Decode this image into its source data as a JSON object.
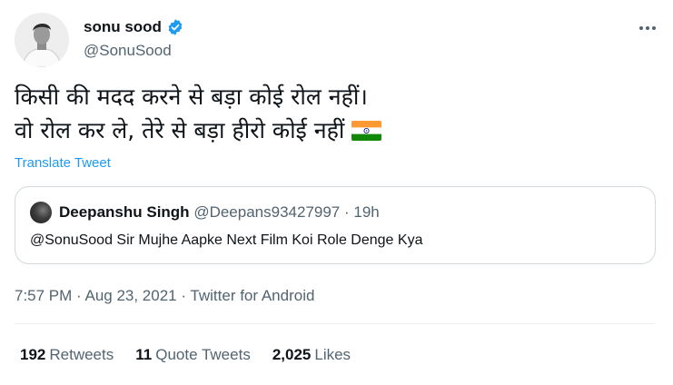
{
  "author": {
    "name": "sonu sood",
    "handle": "@SonuSood",
    "verified_color": "#1d9bf0"
  },
  "more_icon": "more-horizontal-icon",
  "tweet": {
    "lines": [
      "किसी की मदद करने से बड़ा कोई रोल नहीं।",
      "वो रोल कर ले, तेरे से बड़ा हीरो कोई नहीं"
    ],
    "emoji": "indian-flag-icon",
    "translate": "Translate Tweet"
  },
  "quote": {
    "name": "Deepanshu Singh",
    "meta": "@Deepans93427997 · 19h",
    "text": "@SonuSood Sir Mujhe Aapke Next Film Koi Role Denge Kya"
  },
  "timestamp": "7:57 PM · Aug 23, 2021 · Twitter for Android",
  "stats": {
    "retweets_count": "192",
    "retweets_label": "Retweets",
    "quotes_count": "11",
    "quotes_label": "Quote Tweets",
    "likes_count": "2,025",
    "likes_label": "Likes"
  },
  "colors": {
    "accent": "#1d9bf0",
    "text": "#0f1419",
    "secondary": "#536471",
    "border": "#cfd9de"
  }
}
